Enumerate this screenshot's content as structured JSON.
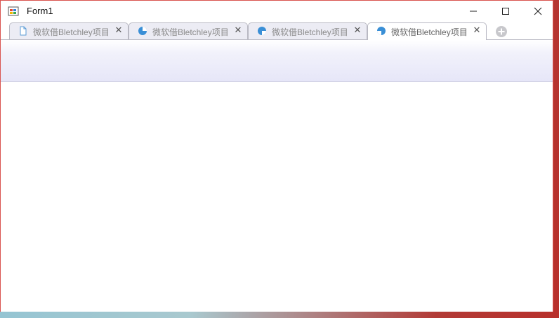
{
  "window": {
    "title": "Form1"
  },
  "caption_buttons": {
    "minimize_icon": "minimize-icon",
    "maximize_icon": "maximize-icon",
    "close_icon": "close-icon"
  },
  "tabs": [
    {
      "label": "微软借Bletchley项目",
      "icon": "document-icon",
      "close": "✕",
      "active": false
    },
    {
      "label": "微软借Bletchley项目",
      "icon": "loading-icon",
      "close": "✕",
      "active": false
    },
    {
      "label": "微软借Bletchley项目",
      "icon": "loading-icon",
      "close": "✕",
      "active": false
    },
    {
      "label": "微软借Bletchley项目",
      "icon": "loading-icon",
      "close": "✕",
      "active": true
    }
  ],
  "new_tab_icon": "add-tab-icon",
  "colors": {
    "accent": "#3a8fd6",
    "tab_bg": "#ececf4",
    "toolbar_bottom": "#e6e6f8",
    "window_border": "#d9534f"
  }
}
